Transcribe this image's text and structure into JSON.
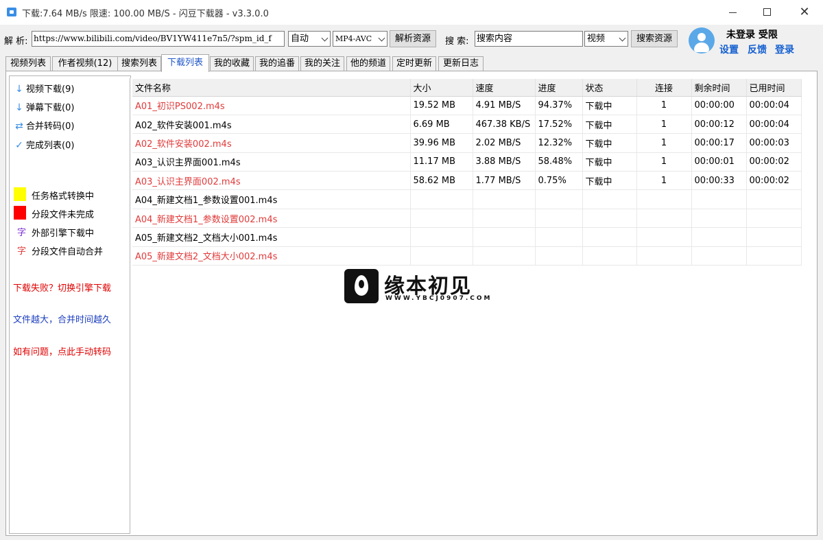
{
  "window": {
    "title": "下载:7.64 MB/s  限速:  100.00 MB/S  - 闪豆下载器 - v3.3.0.0"
  },
  "toolbar": {
    "parse_label": "解 析:",
    "url_value": "https://www.bilibili.com/video/BV1YW411e7n5/?spm_id_f",
    "quality_select": "自动",
    "codec_select": "MP4-AVC",
    "parse_button": "解析资源",
    "search_label": "搜 索:",
    "search_value": "搜索内容",
    "search_type_select": "视频",
    "search_button": "搜索资源"
  },
  "user": {
    "status": "未登录  受限",
    "settings": "设置",
    "feedback": "反馈",
    "login": "登录"
  },
  "tabs": [
    {
      "label": "视频列表"
    },
    {
      "label": "作者视频(12)"
    },
    {
      "label": "搜索列表"
    },
    {
      "label": "下载列表"
    },
    {
      "label": "我的收藏"
    },
    {
      "label": "我的追番"
    },
    {
      "label": "我的关注"
    },
    {
      "label": "他的频道"
    },
    {
      "label": "定时更新"
    },
    {
      "label": "更新日志"
    }
  ],
  "active_tab": "下载列表",
  "sidebar": {
    "items": [
      {
        "label": "视频下载(9)",
        "icon": "arrow-down-icon"
      },
      {
        "label": "弹幕下载(0)",
        "icon": "arrow-down-icon"
      },
      {
        "label": "合并转码(0)",
        "icon": "swap-icon"
      },
      {
        "label": "完成列表(0)",
        "icon": "check-icon"
      }
    ],
    "legend": [
      {
        "label": "任务格式转换中",
        "color": "#ffff00"
      },
      {
        "label": "分段文件未完成",
        "color": "#ff0000"
      },
      {
        "label": "外部引擎下载中",
        "glyph": "字",
        "color": "#7b2fd0"
      },
      {
        "label": "分段文件自动合并",
        "glyph": "字",
        "color": "#e03a3a"
      }
    ],
    "notices": [
      {
        "text": "下载失败？切换引擎下载",
        "color": "#e00000"
      },
      {
        "text": "文件越大，合并时间越久",
        "color": "#1d3fbf"
      },
      {
        "text": "如有问题，点此手动转码",
        "color": "#e00000"
      }
    ]
  },
  "table": {
    "columns": [
      "文件名称",
      "大小",
      "速度",
      "进度",
      "状态",
      "连接",
      "剩余时间",
      "已用时间"
    ],
    "rows": [
      {
        "name": "A01_初识PS002.m4s",
        "size": "19.52 MB",
        "speed": "4.91 MB/S",
        "progress": "94.37%",
        "status": "下载中",
        "conn": "1",
        "remain": "00:00:00",
        "used": "00:00:04",
        "red": true
      },
      {
        "name": "A02_软件安装001.m4s",
        "size": "6.69 MB",
        "speed": "467.38 KB/S",
        "progress": "17.52%",
        "status": "下载中",
        "conn": "1",
        "remain": "00:00:12",
        "used": "00:00:04",
        "red": false
      },
      {
        "name": "A02_软件安装002.m4s",
        "size": "39.96 MB",
        "speed": "2.02 MB/S",
        "progress": "12.32%",
        "status": "下载中",
        "conn": "1",
        "remain": "00:00:17",
        "used": "00:00:03",
        "red": true
      },
      {
        "name": "A03_认识主界面001.m4s",
        "size": "11.17 MB",
        "speed": "3.88 MB/S",
        "progress": "58.48%",
        "status": "下载中",
        "conn": "1",
        "remain": "00:00:01",
        "used": "00:00:02",
        "red": false
      },
      {
        "name": "A03_认识主界面002.m4s",
        "size": "58.62 MB",
        "speed": "1.77 MB/S",
        "progress": "0.75%",
        "status": "下载中",
        "conn": "1",
        "remain": "00:00:33",
        "used": "00:00:02",
        "red": true
      },
      {
        "name": "A04_新建文档1_参数设置001.m4s",
        "size": "",
        "speed": "",
        "progress": "",
        "status": "",
        "conn": "",
        "remain": "",
        "used": "",
        "red": false
      },
      {
        "name": "A04_新建文档1_参数设置002.m4s",
        "size": "",
        "speed": "",
        "progress": "",
        "status": "",
        "conn": "",
        "remain": "",
        "used": "",
        "red": true
      },
      {
        "name": "A05_新建文档2_文档大小001.m4s",
        "size": "",
        "speed": "",
        "progress": "",
        "status": "",
        "conn": "",
        "remain": "",
        "used": "",
        "red": false
      },
      {
        "name": "A05_新建文档2_文档大小002.m4s",
        "size": "",
        "speed": "",
        "progress": "",
        "status": "",
        "conn": "",
        "remain": "",
        "used": "",
        "red": true
      }
    ]
  },
  "watermark": {
    "text": "缘本初见",
    "url": "WWW.YBCJ0907.COM"
  }
}
